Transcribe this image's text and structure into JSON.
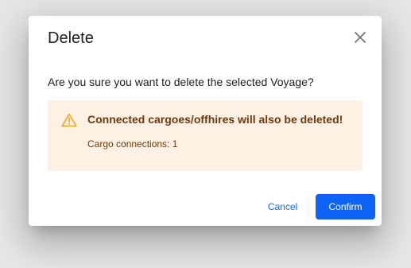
{
  "dialog": {
    "title": "Delete",
    "close_icon": "close-icon",
    "message": "Are you sure you want to delete the selected Voyage?",
    "warning": {
      "icon": "warning-triangle-icon",
      "title": "Connected cargoes/offhires will also be deleted!",
      "detail": "Cargo connections: 1"
    },
    "actions": {
      "cancel_label": "Cancel",
      "confirm_label": "Confirm"
    }
  },
  "colors": {
    "backdrop": "#e6e6e6",
    "warning_background": "#fdf0e4",
    "warning_icon": "#f5a623",
    "warning_text": "#6b3a0e",
    "primary": "#0d63f3",
    "link": "#1565e0"
  }
}
